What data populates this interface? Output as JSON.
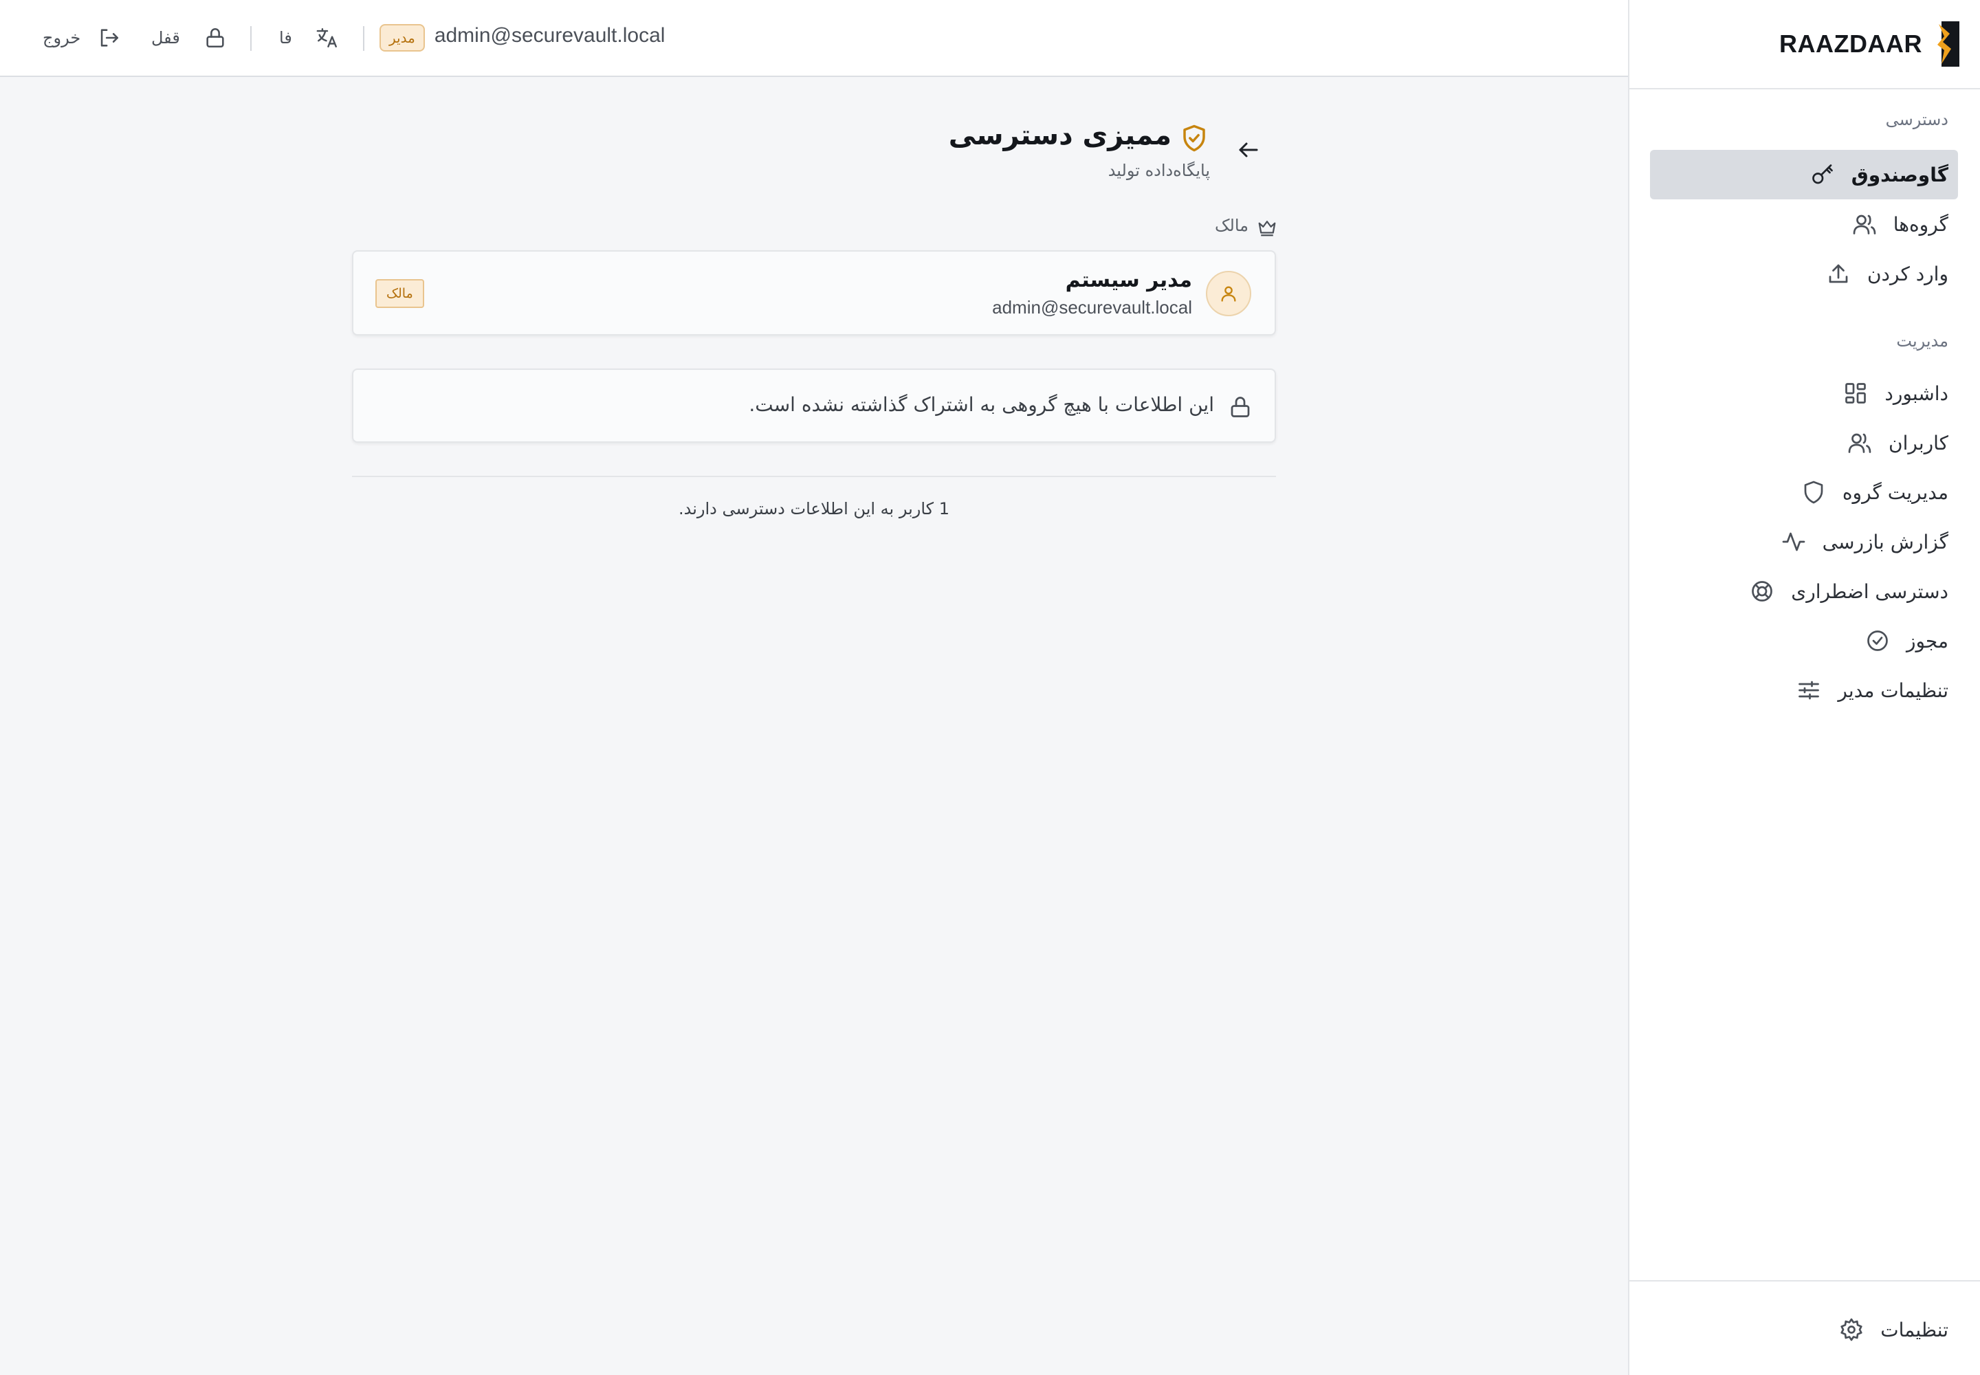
{
  "brand": {
    "name": "RAAZDAAR",
    "accent": "#f0a11d"
  },
  "sidebar": {
    "sections": [
      {
        "label": "دسترسی"
      },
      {
        "label": "مدیریت"
      }
    ],
    "items": [
      {
        "label": "گاوصندوق",
        "icon": "key-icon",
        "active": true
      },
      {
        "label": "گروه‌ها",
        "icon": "users-icon"
      },
      {
        "label": "وارد کردن",
        "icon": "upload-icon"
      },
      {
        "label": "داشبورد",
        "icon": "dashboard-icon"
      },
      {
        "label": "کاربران",
        "icon": "users-icon"
      },
      {
        "label": "مدیریت گروه",
        "icon": "shield-icon"
      },
      {
        "label": "گزارش بازرسی",
        "icon": "activity-icon"
      },
      {
        "label": "دسترسی اضطراری",
        "icon": "lifebuoy-icon"
      },
      {
        "label": "مجوز",
        "icon": "check-circle-icon"
      },
      {
        "label": "تنظیمات مدیر",
        "icon": "sliders-icon"
      }
    ],
    "bottom": {
      "label": "تنظیمات",
      "icon": "gear-icon"
    }
  },
  "topbar": {
    "email": "admin@securevault.local",
    "role": "مدیر",
    "language": "فا",
    "lock_label": "قفل",
    "logout_label": "خروج"
  },
  "page": {
    "title": "ممیزی دسترسی",
    "subtitle": "پایگاه‌داده تولید",
    "owner_section_label": "مالک",
    "owner": {
      "name": "مدیر سیستم",
      "email": "admin@securevault.local",
      "badge": "مالک"
    },
    "notice": "این اطلاعات با هیچ گروهی به اشتراک گذاشته نشده است.",
    "footer": "1 کاربر به این اطلاعات دسترسی دارند."
  }
}
